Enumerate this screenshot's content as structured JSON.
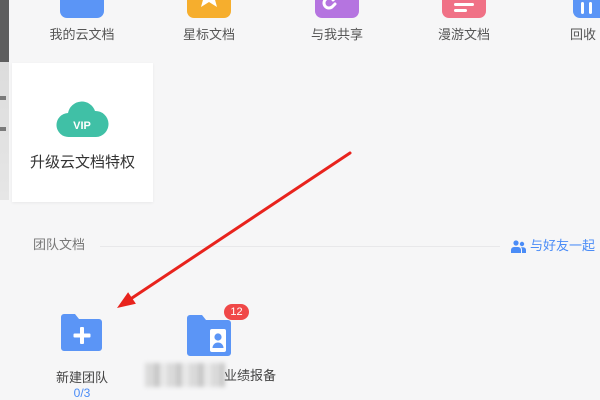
{
  "top_nav": {
    "items": [
      {
        "label": "我的云文档",
        "icon": "folder-icon"
      },
      {
        "label": "星标文档",
        "icon": "star-icon"
      },
      {
        "label": "与我共享",
        "icon": "link-icon"
      },
      {
        "label": "漫游文档",
        "icon": "roaming-icon"
      },
      {
        "label": "回收",
        "icon": "trash-icon"
      }
    ]
  },
  "vip_card": {
    "badge": "VIP",
    "label": "升级云文档特权",
    "icon": "vip-cloud-icon"
  },
  "team_section": {
    "title": "团队文档",
    "invite": {
      "label": "与好友一起",
      "icon": "people-icon"
    }
  },
  "teams": [
    {
      "label": "新建团队",
      "count": "0/3",
      "icon": "add-team-folder-icon"
    },
    {
      "label": "业绩报备",
      "badge": "12",
      "icon": "team-folder-icon"
    }
  ],
  "colors": {
    "background": "#f6f6f7",
    "brand_blue": "#5b95f6",
    "link_blue": "#4a8cf7",
    "star_orange": "#f6ae2d",
    "share_purple": "#b574e0",
    "roaming_pink": "#f07186",
    "vip_teal": "#40c0a6",
    "badge_red": "#f04848",
    "annotation_red": "#e8231d"
  }
}
